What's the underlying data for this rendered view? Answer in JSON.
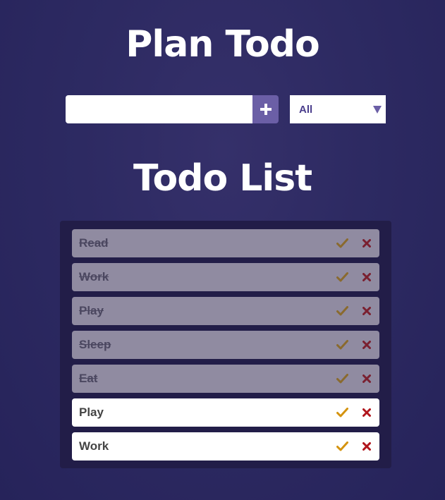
{
  "header": {
    "title": "Plan Todo"
  },
  "form": {
    "input_value": "",
    "input_placeholder": "",
    "add_icon": "plus-icon",
    "filter_selected": "All",
    "filter_icon": "triangle-down-icon"
  },
  "list": {
    "title": "Todo List",
    "items": [
      {
        "text": "Read",
        "completed": true
      },
      {
        "text": "Work",
        "completed": true
      },
      {
        "text": "Play",
        "completed": true
      },
      {
        "text": "Sleep",
        "completed": true
      },
      {
        "text": "Eat",
        "completed": true
      },
      {
        "text": "Play",
        "completed": false
      },
      {
        "text": "Work",
        "completed": false
      }
    ],
    "check_icon": "check-icon",
    "delete_icon": "x-icon"
  },
  "colors": {
    "accent": "#6b5fa6",
    "check_active": "#d4930f",
    "check_done": "#8a6a2e",
    "delete_active": "#b0151c",
    "delete_done": "#7a2030",
    "completed_bg": "#908ba1",
    "active_bg": "#ffffff",
    "panel_bg": "#221d48"
  }
}
